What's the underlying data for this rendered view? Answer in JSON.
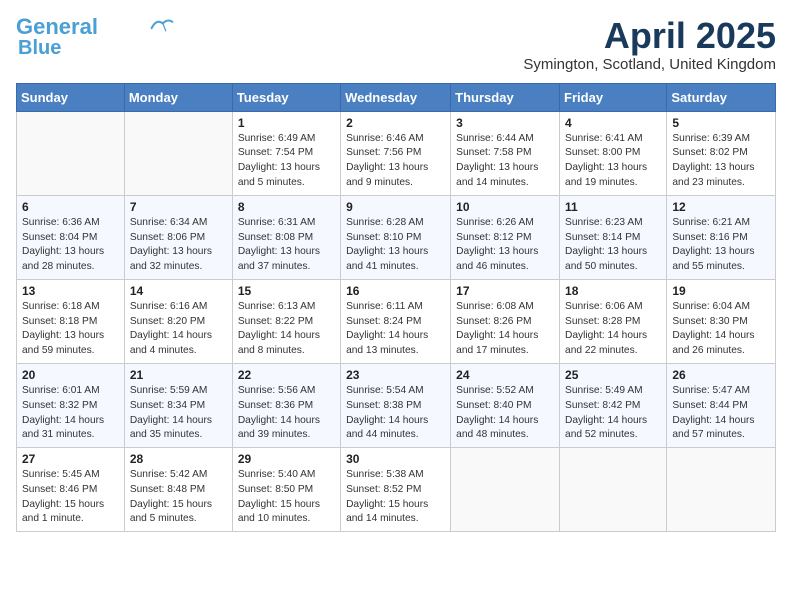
{
  "header": {
    "logo_line1": "General",
    "logo_line2": "Blue",
    "month_title": "April 2025",
    "subtitle": "Symington, Scotland, United Kingdom"
  },
  "weekdays": [
    "Sunday",
    "Monday",
    "Tuesday",
    "Wednesday",
    "Thursday",
    "Friday",
    "Saturday"
  ],
  "weeks": [
    [
      {
        "day": "",
        "info": ""
      },
      {
        "day": "",
        "info": ""
      },
      {
        "day": "1",
        "info": "Sunrise: 6:49 AM\nSunset: 7:54 PM\nDaylight: 13 hours and 5 minutes."
      },
      {
        "day": "2",
        "info": "Sunrise: 6:46 AM\nSunset: 7:56 PM\nDaylight: 13 hours and 9 minutes."
      },
      {
        "day": "3",
        "info": "Sunrise: 6:44 AM\nSunset: 7:58 PM\nDaylight: 13 hours and 14 minutes."
      },
      {
        "day": "4",
        "info": "Sunrise: 6:41 AM\nSunset: 8:00 PM\nDaylight: 13 hours and 19 minutes."
      },
      {
        "day": "5",
        "info": "Sunrise: 6:39 AM\nSunset: 8:02 PM\nDaylight: 13 hours and 23 minutes."
      }
    ],
    [
      {
        "day": "6",
        "info": "Sunrise: 6:36 AM\nSunset: 8:04 PM\nDaylight: 13 hours and 28 minutes."
      },
      {
        "day": "7",
        "info": "Sunrise: 6:34 AM\nSunset: 8:06 PM\nDaylight: 13 hours and 32 minutes."
      },
      {
        "day": "8",
        "info": "Sunrise: 6:31 AM\nSunset: 8:08 PM\nDaylight: 13 hours and 37 minutes."
      },
      {
        "day": "9",
        "info": "Sunrise: 6:28 AM\nSunset: 8:10 PM\nDaylight: 13 hours and 41 minutes."
      },
      {
        "day": "10",
        "info": "Sunrise: 6:26 AM\nSunset: 8:12 PM\nDaylight: 13 hours and 46 minutes."
      },
      {
        "day": "11",
        "info": "Sunrise: 6:23 AM\nSunset: 8:14 PM\nDaylight: 13 hours and 50 minutes."
      },
      {
        "day": "12",
        "info": "Sunrise: 6:21 AM\nSunset: 8:16 PM\nDaylight: 13 hours and 55 minutes."
      }
    ],
    [
      {
        "day": "13",
        "info": "Sunrise: 6:18 AM\nSunset: 8:18 PM\nDaylight: 13 hours and 59 minutes."
      },
      {
        "day": "14",
        "info": "Sunrise: 6:16 AM\nSunset: 8:20 PM\nDaylight: 14 hours and 4 minutes."
      },
      {
        "day": "15",
        "info": "Sunrise: 6:13 AM\nSunset: 8:22 PM\nDaylight: 14 hours and 8 minutes."
      },
      {
        "day": "16",
        "info": "Sunrise: 6:11 AM\nSunset: 8:24 PM\nDaylight: 14 hours and 13 minutes."
      },
      {
        "day": "17",
        "info": "Sunrise: 6:08 AM\nSunset: 8:26 PM\nDaylight: 14 hours and 17 minutes."
      },
      {
        "day": "18",
        "info": "Sunrise: 6:06 AM\nSunset: 8:28 PM\nDaylight: 14 hours and 22 minutes."
      },
      {
        "day": "19",
        "info": "Sunrise: 6:04 AM\nSunset: 8:30 PM\nDaylight: 14 hours and 26 minutes."
      }
    ],
    [
      {
        "day": "20",
        "info": "Sunrise: 6:01 AM\nSunset: 8:32 PM\nDaylight: 14 hours and 31 minutes."
      },
      {
        "day": "21",
        "info": "Sunrise: 5:59 AM\nSunset: 8:34 PM\nDaylight: 14 hours and 35 minutes."
      },
      {
        "day": "22",
        "info": "Sunrise: 5:56 AM\nSunset: 8:36 PM\nDaylight: 14 hours and 39 minutes."
      },
      {
        "day": "23",
        "info": "Sunrise: 5:54 AM\nSunset: 8:38 PM\nDaylight: 14 hours and 44 minutes."
      },
      {
        "day": "24",
        "info": "Sunrise: 5:52 AM\nSunset: 8:40 PM\nDaylight: 14 hours and 48 minutes."
      },
      {
        "day": "25",
        "info": "Sunrise: 5:49 AM\nSunset: 8:42 PM\nDaylight: 14 hours and 52 minutes."
      },
      {
        "day": "26",
        "info": "Sunrise: 5:47 AM\nSunset: 8:44 PM\nDaylight: 14 hours and 57 minutes."
      }
    ],
    [
      {
        "day": "27",
        "info": "Sunrise: 5:45 AM\nSunset: 8:46 PM\nDaylight: 15 hours and 1 minute."
      },
      {
        "day": "28",
        "info": "Sunrise: 5:42 AM\nSunset: 8:48 PM\nDaylight: 15 hours and 5 minutes."
      },
      {
        "day": "29",
        "info": "Sunrise: 5:40 AM\nSunset: 8:50 PM\nDaylight: 15 hours and 10 minutes."
      },
      {
        "day": "30",
        "info": "Sunrise: 5:38 AM\nSunset: 8:52 PM\nDaylight: 15 hours and 14 minutes."
      },
      {
        "day": "",
        "info": ""
      },
      {
        "day": "",
        "info": ""
      },
      {
        "day": "",
        "info": ""
      }
    ]
  ]
}
